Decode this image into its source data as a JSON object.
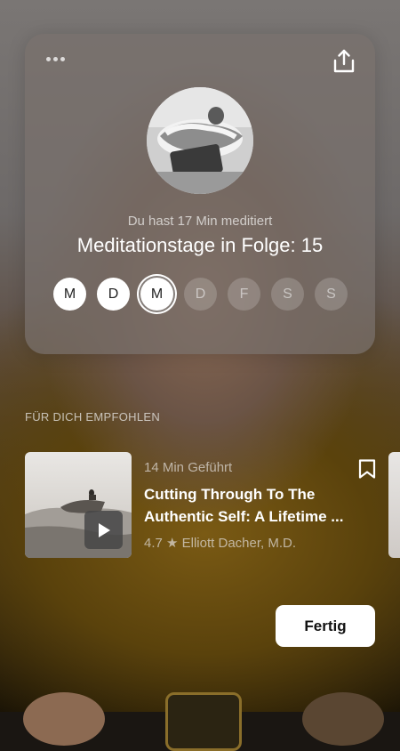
{
  "card": {
    "subtitle": "Du hast 17 Min meditiert",
    "title": "Meditationstage in Folge: 15",
    "days": [
      {
        "letter": "M",
        "state": "done"
      },
      {
        "letter": "D",
        "state": "done"
      },
      {
        "letter": "M",
        "state": "today"
      },
      {
        "letter": "D",
        "state": "future"
      },
      {
        "letter": "F",
        "state": "future"
      },
      {
        "letter": "S",
        "state": "future"
      },
      {
        "letter": "S",
        "state": "future"
      }
    ],
    "icons": {
      "more": "more-icon",
      "share": "share-icon"
    }
  },
  "recommended": {
    "section_label": "FÜR DICH EMPFOHLEN",
    "item": {
      "meta": "14 Min Geführt",
      "title": "Cutting Through To The Authentic Self: A Lifetime ...",
      "rating": "4.7 ★ Elliott Dacher, M.D."
    }
  },
  "done_button": "Fertig",
  "colors": {
    "accent": "#ffffff",
    "card": "#78706c",
    "background": "#1a1612"
  }
}
